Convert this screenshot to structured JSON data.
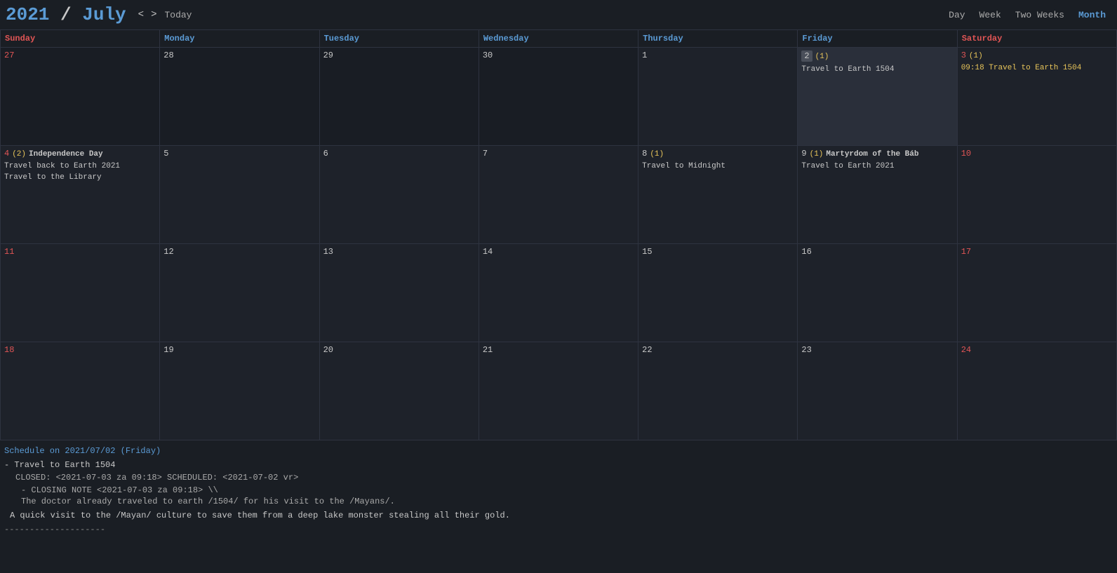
{
  "header": {
    "year": "2021",
    "slash": " / ",
    "month": "July",
    "nav_prev": "<",
    "nav_next": ">",
    "today_label": "Today",
    "views": [
      "Day",
      "Week",
      "Two Weeks",
      "Month"
    ],
    "active_view": "Month"
  },
  "days_of_week": [
    {
      "label": "Sunday",
      "class": "sunday"
    },
    {
      "label": "Monday",
      "class": "monday"
    },
    {
      "label": "Tuesday",
      "class": "tuesday"
    },
    {
      "label": "Wednesday",
      "class": "wednesday"
    },
    {
      "label": "Thursday",
      "class": "thursday"
    },
    {
      "label": "Friday",
      "class": "friday"
    },
    {
      "label": "Saturday",
      "class": "saturday"
    }
  ],
  "weeks": [
    {
      "days": [
        {
          "num": "27",
          "other": true,
          "class": "sunday"
        },
        {
          "num": "28",
          "other": true,
          "class": "monday"
        },
        {
          "num": "29",
          "other": true,
          "class": "tuesday"
        },
        {
          "num": "30",
          "other": true,
          "class": "wednesday"
        },
        {
          "num": "1",
          "other": false,
          "class": "thursday",
          "events": []
        },
        {
          "num": "2",
          "other": false,
          "class": "friday",
          "today": true,
          "count": "(1)",
          "events": [
            "Travel to Earth 1504"
          ]
        },
        {
          "num": "3",
          "other": false,
          "class": "saturday",
          "count": "(1)",
          "events": [
            "09:18 Travel to Earth 1504"
          ]
        }
      ]
    },
    {
      "days": [
        {
          "num": "4",
          "other": false,
          "class": "sunday",
          "count": "(2)",
          "holiday": "Independence Day",
          "events": [
            "Travel back to Earth 2021",
            "Travel to the Library"
          ]
        },
        {
          "num": "5",
          "other": false,
          "class": "monday"
        },
        {
          "num": "6",
          "other": false,
          "class": "tuesday"
        },
        {
          "num": "7",
          "other": false,
          "class": "wednesday"
        },
        {
          "num": "8",
          "other": false,
          "class": "thursday",
          "count": "(1)",
          "events": [
            "Travel to Midnight"
          ]
        },
        {
          "num": "9",
          "other": false,
          "class": "friday",
          "count": "(1)",
          "holiday": "Martyrdom of the Báb",
          "events": [
            "Travel to Earth 2021"
          ]
        },
        {
          "num": "10",
          "other": false,
          "class": "saturday"
        }
      ]
    },
    {
      "days": [
        {
          "num": "11",
          "other": false,
          "class": "sunday"
        },
        {
          "num": "12",
          "other": false,
          "class": "monday"
        },
        {
          "num": "13",
          "other": false,
          "class": "tuesday"
        },
        {
          "num": "14",
          "other": false,
          "class": "wednesday"
        },
        {
          "num": "15",
          "other": false,
          "class": "thursday"
        },
        {
          "num": "16",
          "other": false,
          "class": "friday"
        },
        {
          "num": "17",
          "other": false,
          "class": "saturday"
        }
      ]
    },
    {
      "days": [
        {
          "num": "18",
          "other": false,
          "class": "sunday"
        },
        {
          "num": "19",
          "other": false,
          "class": "monday"
        },
        {
          "num": "20",
          "other": false,
          "class": "tuesday"
        },
        {
          "num": "21",
          "other": false,
          "class": "wednesday"
        },
        {
          "num": "22",
          "other": false,
          "class": "thursday"
        },
        {
          "num": "23",
          "other": false,
          "class": "friday"
        },
        {
          "num": "24",
          "other": false,
          "class": "saturday"
        }
      ]
    }
  ],
  "schedule": {
    "header": "Schedule on 2021/07/02 (Friday)",
    "items": [
      {
        "title": "- Travel to Earth 1504",
        "meta": "CLOSED: <2021-07-03 za 09:18> SCHEDULED: <2021-07-02 vr>",
        "note_label": "- CLOSING NOTE <2021-07-03 za 09:18> \\\\",
        "note_detail": "The doctor already traveled to earth /1504/ for his visit to the /Mayans/.",
        "desc": "A quick visit to the /Mayan/ culture to save them from a deep lake monster stealing all their gold."
      }
    ],
    "divider": "--------------------"
  }
}
